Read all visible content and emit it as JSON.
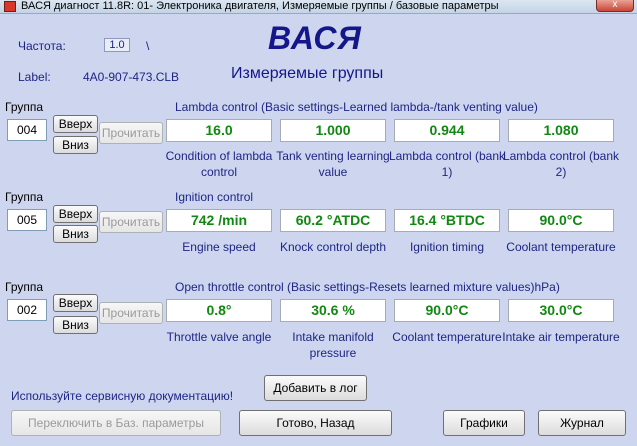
{
  "window": {
    "title": "ВАСЯ диагност 11.8R: 01- Электроника двигателя,  Измеряемые группы / базовые параметры",
    "close_label": "x"
  },
  "header": {
    "freq_label": "Частота:",
    "freq_value": "1.0",
    "freq_suffix": "\\",
    "label_key": "Label:",
    "label_value": "4A0-907-473.CLB",
    "brand": "ВАСЯ",
    "subtitle": "Измеряемые группы"
  },
  "buttons": {
    "up": "Вверх",
    "down": "Вниз",
    "read": "Прочитать"
  },
  "groups": [
    {
      "group_label": "Группа",
      "number": "004",
      "title": "Lambda control (Basic settings-Learned lambda-/tank venting value)",
      "fields": [
        {
          "value": "16.0",
          "label": "Condition of lambda control"
        },
        {
          "value": "1.000",
          "label": "Tank venting learning value"
        },
        {
          "value": "0.944",
          "label": "Lambda control (bank 1)"
        },
        {
          "value": "1.080",
          "label": "Lambda control (bank 2)"
        }
      ]
    },
    {
      "group_label": "Группа",
      "number": "005",
      "title": "Ignition control",
      "fields": [
        {
          "value": "742 /min",
          "label": "Engine speed"
        },
        {
          "value": "60.2 °ATDC",
          "label": "Knock control depth"
        },
        {
          "value": "16.4 °BTDC",
          "label": "Ignition timing"
        },
        {
          "value": "90.0°C",
          "label": "Coolant temperature"
        }
      ]
    },
    {
      "group_label": "Группа",
      "number": "002",
      "title": "Open throttle control (Basic settings-Resets learned mixture values)hPa)",
      "fields": [
        {
          "value": "0.8°",
          "label": "Throttle valve angle"
        },
        {
          "value": "30.6 %",
          "label": "Intake manifold pressure"
        },
        {
          "value": "90.0°C",
          "label": "Coolant temperature"
        },
        {
          "value": "30.0°C",
          "label": "Intake air temperature"
        }
      ]
    }
  ],
  "footer": {
    "hint": "Используйте сервисную документацию!",
    "add_log": "Добавить в лог",
    "switch_basic": "Переключить в Баз. параметры",
    "done_back": "Готово, Назад",
    "graphs": "Графики",
    "log": "Журнал"
  }
}
